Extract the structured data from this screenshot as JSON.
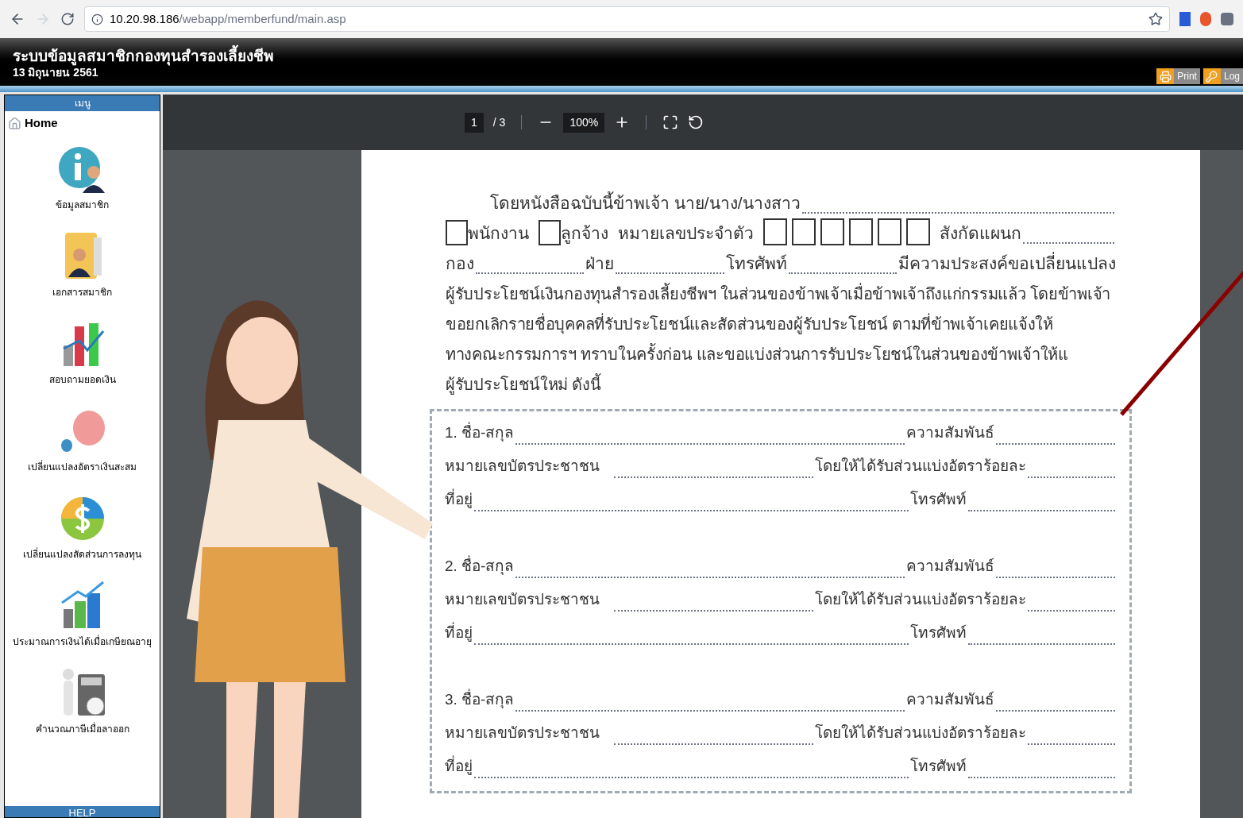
{
  "browser": {
    "url_host": "10.20.98.186",
    "url_path": "/webapp/memberfund/main.asp"
  },
  "header": {
    "title": "ระบบข้อมูลสมาชิกกองทุนสำรองเลี้ยงชีพ",
    "date": "13 มิถุนายน 2561",
    "buttons": [
      {
        "kind": "print",
        "label": "Print"
      },
      {
        "kind": "login",
        "label": "Log"
      }
    ]
  },
  "sidebar": {
    "heading": "เมนู",
    "home": "Home",
    "footer": "HELP",
    "items": [
      {
        "kind": "info",
        "label": "ข้อมูลสมาชิก"
      },
      {
        "kind": "folder",
        "label": "เอกสารสมาชิก"
      },
      {
        "kind": "chart",
        "label": "สอบถามยอดเงิน"
      },
      {
        "kind": "piggy",
        "label": "เปลี่ยนแปลงอัตราเงินสะสม"
      },
      {
        "kind": "coin",
        "label": "เปลี่ยนแปลงสัดส่วนการลงทุน"
      },
      {
        "kind": "growth",
        "label": "ประมาณการเงินได้เมื่อเกษียณอายุ"
      },
      {
        "kind": "tax",
        "label": "คำนวณภาษีเมื่อลาออก"
      }
    ]
  },
  "viewer": {
    "page": "1",
    "pages": "/ 3",
    "zoom": "100%"
  },
  "document": {
    "intro": "โดยหนังสือฉบับนี้ข้าพเจ้า นาย/นาง/นางสาว",
    "line2": {
      "options": [
        {
          "label": "พนักงาน",
          "checked": false
        },
        {
          "label": "ลูกจ้าง",
          "checked": false
        }
      ],
      "id_label": "หมายเลขประจำตัว",
      "dept_label": "สังกัดแผนก"
    },
    "line3": [
      "กอง",
      "ฝ่าย",
      "โทรศัพท์"
    ],
    "line3_end": "มีความประสงค์ขอเปลี่ยนแปลง",
    "paragraph": [
      "ผู้รับประโยชน์เงินกองทุนสำรองเลี้ยงชีพฯ ในส่วนของข้าพเจ้าเมื่อข้าพเจ้าถึงแก่กรรมแล้ว โดยข้าพเจ้า",
      "ขอยกเลิกรายชื่อบุคคลที่รับประโยชน์และสัดส่วนของผู้รับประโยชน์ ตามที่ข้าพเจ้าเคยแจ้งให้",
      "ทางคณะกรรมการฯ ทราบในครั้งก่อน และขอแบ่งส่วนการรับประโยชน์ในส่วนของข้าพเจ้าให้แ",
      "ผู้รับประโยชน์ใหม่ ดังนี้"
    ],
    "beneficiaries": [
      {
        "name": "1. ชื่อ-สกุล",
        "relation": "ความสัมพันธ์",
        "id": "หมายเลขบัตรประชาชน",
        "share": "โดยให้ได้รับส่วนแบ่งอัตราร้อยละ",
        "address": "ที่อยู่",
        "phone": "โทรศัพท์"
      },
      {
        "name": "2. ชื่อ-สกุล",
        "relation": "ความสัมพันธ์",
        "id": "หมายเลขบัตรประชาชน",
        "share": "โดยให้ได้รับส่วนแบ่งอัตราร้อยละ",
        "address": "ที่อยู่",
        "phone": "โทรศัพท์"
      },
      {
        "name": "3. ชื่อ-สกุล",
        "relation": "ความสัมพันธ์",
        "id": "หมายเลขบัตรประชาชน",
        "share": "โดยให้ได้รับส่วนแบ่งอัตราร้อยละ",
        "address": "ที่อยู่",
        "phone": "โทรศัพท์"
      }
    ]
  }
}
